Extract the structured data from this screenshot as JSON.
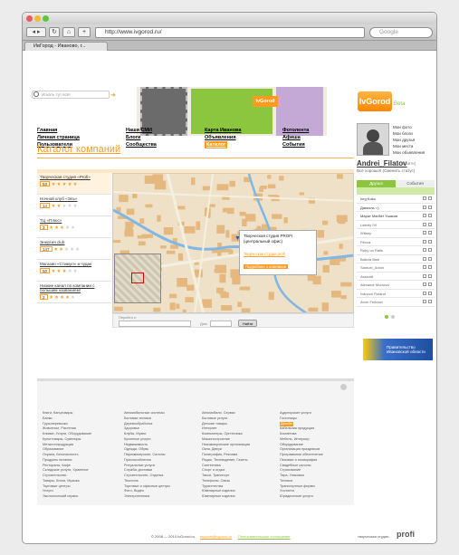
{
  "browser": {
    "url": "http://www.ivgorod.ru/",
    "search_placeholder": "Google",
    "tab_title": "ИвГород - Иваново, г..."
  },
  "header": {
    "search_placeholder": "Искать тут всё!",
    "logo": "IvGorod",
    "logo_suffix": "Beta",
    "banner_label": "IvGorod"
  },
  "nav": [
    [
      "Главная",
      "Личная страница",
      "Пользователи"
    ],
    [
      "Наши СМИ",
      "Блоги",
      "Сообщества"
    ],
    [
      "Карта Иванова",
      "Объявления",
      "Каталог"
    ],
    [
      "Фотолента",
      "Афиша",
      "События"
    ]
  ],
  "user": {
    "name": "Andrei_Filatov",
    "status": "(Выйти)",
    "greeting": "Всё хорошо!! (Сменить статус)",
    "menu": [
      "Мои фото",
      "Мои блоги",
      "Мои друзья",
      "Мои места",
      "Мои объявления"
    ]
  },
  "catalog": {
    "title": "Каталог компаний",
    "cards": [
      {
        "name": "Творческая студия «Profi»",
        "count": "53",
        "rating": 5
      },
      {
        "name": "Ночной клуб «Эль»",
        "count": "14",
        "rating": 2
      },
      {
        "name": "ТЦ «Плюс»",
        "count": "3",
        "rating": 3
      },
      {
        "name": "Энергия club",
        "count": "147",
        "rating": 2
      },
      {
        "name": "Магазин «Стимул» и чудак",
        "count": "50",
        "rating": 3
      },
      {
        "name": "Низкие канал по компании с большим названием!",
        "count": "2",
        "rating": 4
      }
    ],
    "popup": {
      "title": "Творческая студия PROFI (центральный офис)",
      "link1": "Творческая студия profi",
      "link2": "Подробнее о компании"
    },
    "search": {
      "label": "Перейти к:",
      "label2": "Дом",
      "button": "Найти"
    }
  },
  "friends_tabs": [
    "Друзья",
    "События"
  ],
  "friends": [
    "Ivrg Koko",
    "Даниэль =)",
    "Марат Магбат Ушаков",
    "Laterty IVI",
    "Witsey",
    "Рёсса",
    "Ruby on Rails",
    "Babcia Basi",
    "Samuel_Anlon",
    "Assboltt",
    "Alexandr Morozov",
    "Ivanovo Roland",
    "Anon Fedorov"
  ],
  "ad": {
    "text": "Правительство Ивановской области"
  },
  "categories": [
    [
      "Книги, Канцтовары",
      "Банки",
      "Грузоперевозки",
      "Животные, Растения",
      "Климат, Услуги, Оборудование",
      "Культтовары, Сувениры",
      "Металлопродукция",
      "Образование",
      "Охрана, Безопасность",
      "Продукты питания",
      "Рестораны, Кафе",
      "Складские услуги, Хранение",
      "Строительство",
      "Товары, Книги, Музыка",
      "Торговые центры",
      "Услуги",
      "Экологический сервис"
    ],
    [
      "Автомобильные системы",
      "Бытовая техника",
      "Деревообработка",
      "Здоровье",
      "Клубы, Музеи",
      "Кухонные услуги",
      "Недвижимость",
      "Одежда, Обувь",
      "Парикмахерские, Салоны",
      "Приспособления",
      "Ритуальные услуги",
      "Службы доставки",
      "Строительство, Отделка",
      "Текстиль",
      "Торговые и офисные центры",
      "Фото, Видео",
      "Электротехника"
    ],
    [
      "Автомобили, Сервис",
      "Бытовые услуги",
      "Детские товары",
      "Интернет",
      "Компьютеры, Оргтехника",
      "Машиностроение",
      "Некоммерческие организации",
      "Окна, Двери",
      "Полиграфия, Реклама",
      "Радио, Телевидение, Газеты",
      "Сантехника",
      "Спорт и отдых",
      "Такси, Транспорт",
      "Телефоны, Связь",
      "Турагентства",
      "Ювелирные изделия",
      "Ювелирные изделия"
    ],
    [
      "Аудиторские услуги",
      "Гостиницы",
      "Дизайн",
      "Кабельная продукция",
      "Косметика",
      "Мебель, Интерьер",
      "Оборудование",
      "Организация праздников",
      "Программное обеспечение",
      "Пековые и поликрафия",
      "Свадебные салоны",
      "Страхование",
      "Тара, Упаковка",
      "Техника",
      "Транспортные фирмы",
      "Хостинги",
      "Юридические услуги"
    ]
  ],
  "footer": {
    "copyright": "© 2008 — 2010 IvGorod.ru",
    "email": "support@ivgorod.ru",
    "agreement": "Пользовательское соглашение",
    "studio": "творческая студия",
    "studio_logo": "profi"
  },
  "colors": {
    "accent": "#ff9a1f",
    "green": "#8cc63f"
  }
}
